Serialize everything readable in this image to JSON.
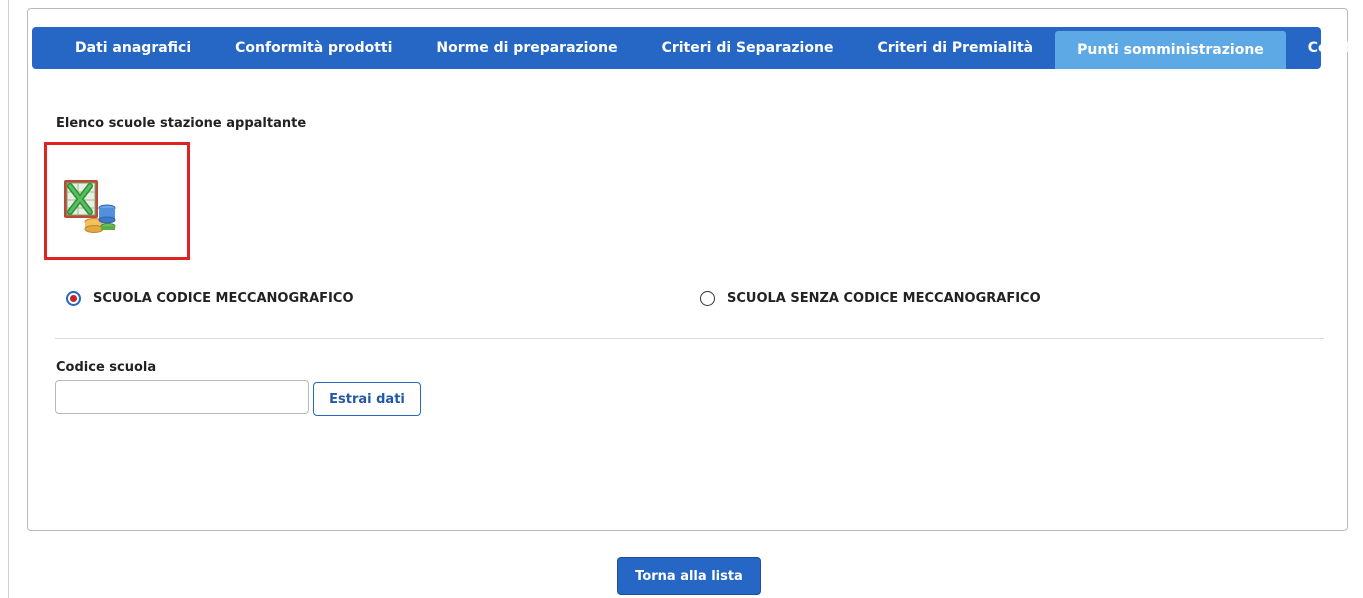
{
  "tabs": [
    {
      "label": "Dati anagrafici",
      "active": false
    },
    {
      "label": "Conformità prodotti",
      "active": false
    },
    {
      "label": "Norme di preparazione",
      "active": false
    },
    {
      "label": "Criteri di Separazione",
      "active": false
    },
    {
      "label": "Criteri di Premialità",
      "active": false
    },
    {
      "label": "Punti somministrazione",
      "active": true
    },
    {
      "label": "Conclusione",
      "active": false
    }
  ],
  "section_label": "Elenco scuole stazione appaltante",
  "export_icon": "excel-database-icon",
  "radios": [
    {
      "label": "SCUOLA CODICE MECCANOGRAFICO",
      "checked": true
    },
    {
      "label": "SCUOLA SENZA CODICE MECCANOGRAFICO",
      "checked": false
    }
  ],
  "code_field": {
    "label": "Codice scuola",
    "value": "",
    "placeholder": ""
  },
  "extract_button": "Estrai dati",
  "back_button": "Torna alla lista",
  "colors": {
    "tab_bar": "#2667c6",
    "active_tab": "#5da9e6",
    "highlight_box": "#e02222",
    "radio_dot": "#c0262c"
  }
}
